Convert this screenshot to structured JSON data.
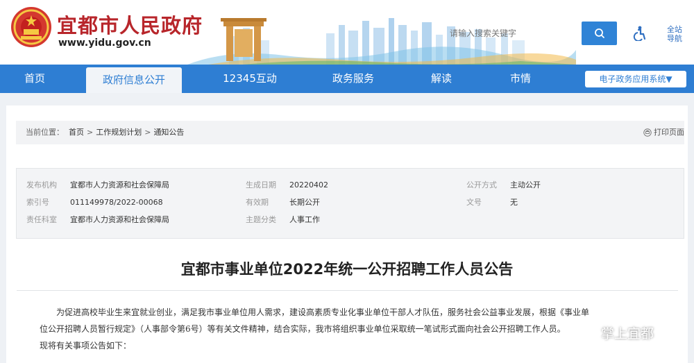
{
  "header": {
    "site_title": "宜都市人民政府",
    "site_url": "www.yidu.gov.cn",
    "search_placeholder": "请输入搜索关键字",
    "site_nav": "全站导航"
  },
  "nav": {
    "items": [
      "首页",
      "政府信息公开",
      "12345互动",
      "政务服务",
      "解读",
      "市情"
    ],
    "active": "政府信息公开",
    "apps_label": "电子政务应用系统▼"
  },
  "breadcrumb": {
    "label": "当前位置：",
    "items": [
      "首页",
      "工作规划计划",
      "通知公告"
    ],
    "separator": ">",
    "print_label": "打印页面"
  },
  "meta": {
    "rows": [
      [
        [
          "发布机构",
          "宜都市人力资源和社会保障局"
        ],
        [
          "生成日期",
          "20220402"
        ],
        [
          "公开方式",
          "主动公开"
        ]
      ],
      [
        [
          "索引号",
          "011149978/2022-00068"
        ],
        [
          "有效期",
          "长期公开"
        ],
        [
          "文号",
          "无"
        ]
      ],
      [
        [
          "责任科室",
          "宜都市人力资源和社会保障局"
        ],
        [
          "主题分类",
          "人事工作"
        ]
      ]
    ]
  },
  "article": {
    "title": "宜都市事业单位2022年统一公开招聘工作人员公告",
    "body_line1": "为促进高校毕业生来宜就业创业，满足我市事业单位用人需求，建设高素质专业化事业单位干部人才队伍，服务社会公益事业发展，根据《事业单",
    "body_line2": "位公开招聘人员暂行规定》（人事部令第6号）等有关文件精神，结合实际，我市将组织事业单位采取统一笔试形式面向社会公开招聘工作人员。",
    "body_line3": "现将有关事项公告如下："
  },
  "watermark": "掌上宜都",
  "colors": {
    "brand_red": "#b8262b",
    "nav_blue": "#2e7ed3",
    "search_blue": "#2f83d6"
  }
}
